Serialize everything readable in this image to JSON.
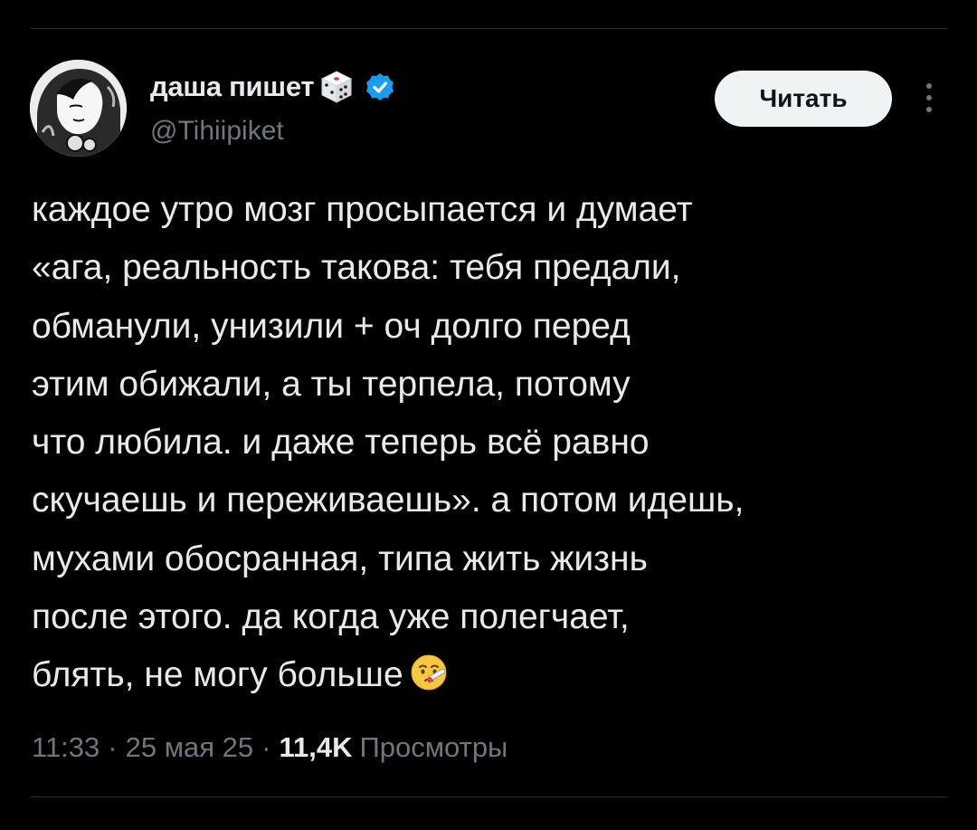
{
  "user": {
    "display_name": "даша пишет",
    "handle": "@Tihiipiket",
    "avatar_icon": "avatar-illustration",
    "badge_emoji_icon": "dice-icon",
    "verified_icon": "verified-badge-icon",
    "verified_color": "#1d9bf0"
  },
  "actions": {
    "follow_label": "Читать",
    "more_icon": "more-vertical-icon"
  },
  "tweet": {
    "lines": [
      "каждое утро мозг просыпается и думает",
      "«ага, реальность такова: тебя предали,",
      "обманули, унизили + оч долго перед",
      "этим обижали, а ты терпела, потому",
      "что любила. и даже теперь всё равно",
      "скучаешь и переживаешь». а потом идешь,",
      "мухами обосранная, типа жить жизнь",
      "после этого. да когда уже полегчает,",
      "блять, не могу больше"
    ],
    "trailing_emoji_icon": "face-with-thermometer-icon"
  },
  "meta": {
    "time": "11:33",
    "separator": "·",
    "date": "25 мая 25",
    "views_count": "11,4K",
    "views_label": "Просмотры"
  },
  "colors": {
    "background": "#000000",
    "text_primary": "#e7e9ea",
    "text_secondary": "#71767b",
    "divider": "#2f3336",
    "button_bg": "#eff3f4",
    "button_text": "#0f1419"
  }
}
